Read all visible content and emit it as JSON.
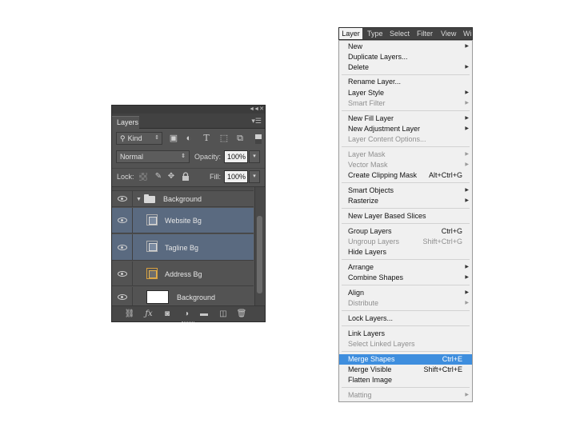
{
  "layers_panel": {
    "tab_label": "Layers",
    "kind_label": "Kind",
    "blend_mode": "Normal",
    "opacity_label": "Opacity:",
    "opacity_value": "100%",
    "lock_label": "Lock:",
    "fill_label": "Fill:",
    "fill_value": "100%",
    "layers": [
      {
        "name": "Background",
        "type": "group",
        "visible": true,
        "selected": false
      },
      {
        "name": "Website Bg",
        "type": "shape",
        "visible": true,
        "selected": true
      },
      {
        "name": "Tagline Bg",
        "type": "shape",
        "visible": true,
        "selected": true
      },
      {
        "name": "Address Bg",
        "type": "shape",
        "visible": true,
        "selected": false
      },
      {
        "name": "Background",
        "type": "background",
        "visible": true,
        "selected": false,
        "locked": true
      }
    ],
    "bottom_icons": [
      "link-layers-icon",
      "fx-icon",
      "add-mask-icon",
      "adjustment-layer-icon",
      "new-group-icon",
      "new-layer-icon",
      "delete-layer-icon"
    ],
    "colors": {
      "panel_bg": "#535353",
      "selected_row": "#5a6a80"
    }
  },
  "menubar": {
    "items": [
      "Layer",
      "Type",
      "Select",
      "Filter",
      "View",
      "Wi"
    ]
  },
  "layer_menu": {
    "items": [
      {
        "label": "New",
        "submenu": true
      },
      {
        "label": "Duplicate Layers..."
      },
      {
        "label": "Delete",
        "submenu": true
      },
      {
        "label": "Rename Layer..."
      },
      {
        "label": "Layer Style",
        "submenu": true
      },
      {
        "label": "Smart Filter",
        "submenu": true,
        "disabled": true
      },
      {
        "label": "New Fill Layer",
        "submenu": true
      },
      {
        "label": "New Adjustment Layer",
        "submenu": true
      },
      {
        "label": "Layer Content Options...",
        "disabled": true
      },
      {
        "label": "Layer Mask",
        "submenu": true,
        "disabled": true
      },
      {
        "label": "Vector Mask",
        "submenu": true,
        "disabled": true
      },
      {
        "label": "Create Clipping Mask",
        "shortcut": "Alt+Ctrl+G"
      },
      {
        "label": "Smart Objects",
        "submenu": true
      },
      {
        "label": "Rasterize",
        "submenu": true
      },
      {
        "label": "New Layer Based Slices"
      },
      {
        "label": "Group Layers",
        "shortcut": "Ctrl+G"
      },
      {
        "label": "Ungroup Layers",
        "shortcut": "Shift+Ctrl+G",
        "disabled": true
      },
      {
        "label": "Hide Layers"
      },
      {
        "label": "Arrange",
        "submenu": true
      },
      {
        "label": "Combine Shapes",
        "submenu": true
      },
      {
        "label": "Align",
        "submenu": true
      },
      {
        "label": "Distribute",
        "submenu": true,
        "disabled": true
      },
      {
        "label": "Lock Layers..."
      },
      {
        "label": "Link Layers"
      },
      {
        "label": "Select Linked Layers",
        "disabled": true
      },
      {
        "label": "Merge Shapes",
        "shortcut": "Ctrl+E",
        "highlighted": true
      },
      {
        "label": "Merge Visible",
        "shortcut": "Shift+Ctrl+E"
      },
      {
        "label": "Flatten Image"
      },
      {
        "label": "Matting",
        "submenu": true,
        "disabled": true
      }
    ],
    "colors": {
      "highlight": "#3e8ede",
      "disabled_text": "#8f8f8f"
    }
  }
}
